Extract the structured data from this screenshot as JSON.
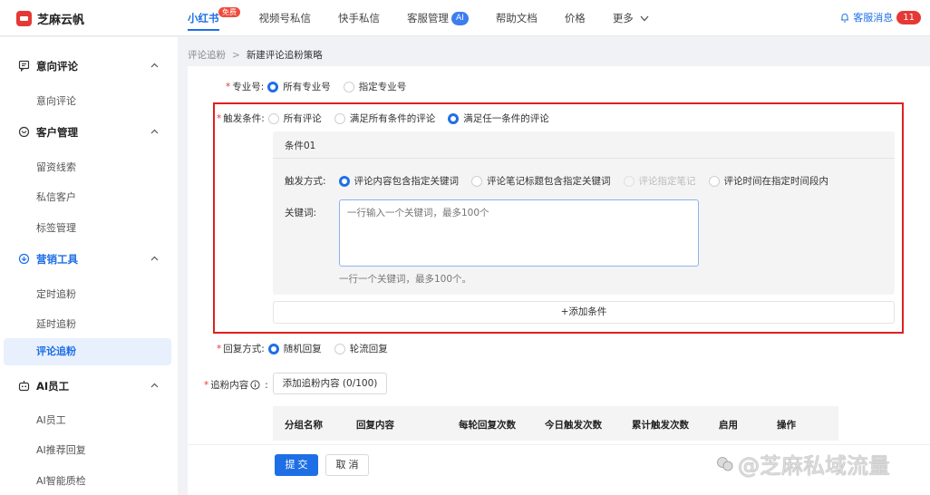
{
  "brand": {
    "name": "芝麻云帆"
  },
  "nav": {
    "items": [
      {
        "label": "小红书",
        "badge": "免费",
        "active": true
      },
      {
        "label": "视频号私信"
      },
      {
        "label": "快手私信"
      },
      {
        "label": "客服管理",
        "badge": "AI"
      },
      {
        "label": "帮助文档"
      },
      {
        "label": "价格"
      },
      {
        "label": "更多"
      }
    ],
    "messages": {
      "label": "客服消息",
      "count": "11"
    }
  },
  "sidebar": {
    "cut_text": "一一一一一一",
    "groups": [
      {
        "label": "意向评论",
        "icon": "message-square-icon",
        "items": [
          "意向评论"
        ]
      },
      {
        "label": "客户管理",
        "icon": "users-icon",
        "items": [
          "留资线索",
          "私信客户",
          "标签管理"
        ]
      },
      {
        "label": "营销工具",
        "icon": "gift-icon",
        "items": [
          "定时追粉",
          "延时追粉",
          "评论追粉"
        ],
        "active_item": "评论追粉"
      },
      {
        "label": "AI员工",
        "icon": "robot-icon",
        "items": [
          "AI员工",
          "AI推荐回复",
          "AI智能质检"
        ]
      }
    ]
  },
  "breadcrumb": {
    "parent": "评论追粉",
    "current": "新建评论追粉策略"
  },
  "form": {
    "account": {
      "label": "专业号:",
      "options": [
        {
          "label": "所有专业号",
          "selected": true
        },
        {
          "label": "指定专业号",
          "selected": false
        }
      ]
    },
    "trigger": {
      "label": "触发条件:",
      "options": [
        {
          "label": "所有评论",
          "selected": false
        },
        {
          "label": "满足所有条件的评论",
          "selected": false
        },
        {
          "label": "满足任一条件的评论",
          "selected": true
        }
      ],
      "condition": {
        "title": "条件01",
        "method_label": "触发方式:",
        "methods": [
          {
            "label": "评论内容包含指定关键词",
            "selected": true,
            "disabled": false
          },
          {
            "label": "评论笔记标题包含指定关键词",
            "selected": false,
            "disabled": false
          },
          {
            "label": "评论指定笔记",
            "selected": false,
            "disabled": true
          },
          {
            "label": "评论时间在指定时间段内",
            "selected": false,
            "disabled": false
          }
        ],
        "keyword_label": "关键词:",
        "keyword_placeholder": "一行输入一个关键词，最多100个",
        "keyword_tip": "一行一个关键词，最多100个。"
      },
      "add_condition": "+添加条件"
    },
    "reply": {
      "label": "回复方式:",
      "options": [
        {
          "label": "随机回复",
          "selected": true
        },
        {
          "label": "轮流回复",
          "selected": false
        }
      ]
    },
    "content": {
      "label": "追粉内容",
      "add_button": "添加追粉内容 (0/100)",
      "columns": [
        "分组名称",
        "回复内容",
        "每轮回复次数",
        "今日触发次数",
        "累计触发次数",
        "启用",
        "操作"
      ]
    },
    "submit": "提 交",
    "cancel": "取 消"
  },
  "watermark": "@芝麻私域流量",
  "colors": {
    "primary": "#1e6fe5",
    "highlight_border": "#e02020",
    "required": "#e53935"
  }
}
